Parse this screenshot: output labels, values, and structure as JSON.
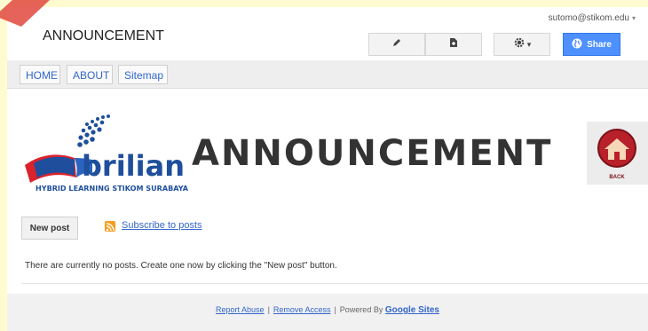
{
  "header": {
    "site_title": "ANNOUNCEMENT",
    "user_email": "sutomo@stikom.edu",
    "user_caret": "▾",
    "settings_caret": "▾",
    "share_label": "Share"
  },
  "nav": {
    "tabs": [
      "HOME",
      "ABOUT",
      "Sitemap"
    ]
  },
  "page": {
    "logo_word": "brilian",
    "logo_tagline": "HYBRID LEARNING STIKOM SURABAYA",
    "banner": "ANNOUNCEMENT",
    "back_label": "BACK",
    "new_post_label": "New post",
    "subscribe_label": "Subscribe to posts",
    "empty_message": "There are currently no posts. Create one now by clicking the \"New post\" button."
  },
  "footer": {
    "report_abuse": "Report Abuse",
    "remove_access": "Remove Access",
    "powered_by": "Powered By",
    "google_sites": "Google Sites",
    "separator": "|"
  },
  "colors": {
    "page_background": "#fffbd0",
    "share_button": "#4d90fe",
    "link": "#3366cc",
    "rss": "#f79c1d",
    "logo_blue": "#1f4f9c",
    "logo_red": "#d9232d"
  }
}
